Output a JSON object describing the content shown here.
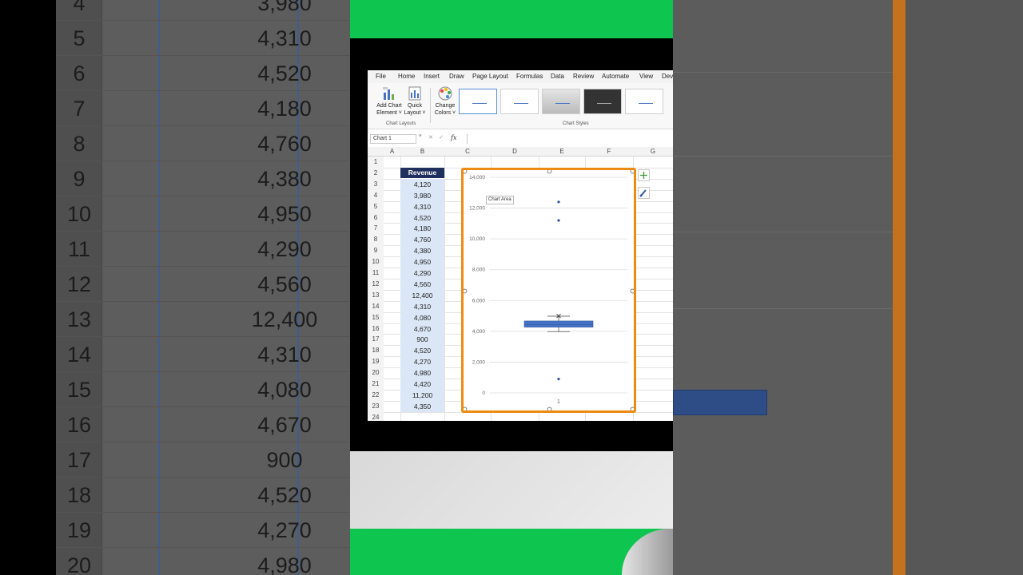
{
  "background_sheet": {
    "rows": [
      {
        "n": "4",
        "v": "3,980"
      },
      {
        "n": "5",
        "v": "4,310"
      },
      {
        "n": "6",
        "v": "4,520"
      },
      {
        "n": "7",
        "v": "4,180"
      },
      {
        "n": "8",
        "v": "4,760"
      },
      {
        "n": "9",
        "v": "4,380"
      },
      {
        "n": "10",
        "v": "4,950"
      },
      {
        "n": "11",
        "v": "4,290"
      },
      {
        "n": "12",
        "v": "4,560"
      },
      {
        "n": "13",
        "v": "12,400"
      },
      {
        "n": "14",
        "v": "4,310"
      },
      {
        "n": "15",
        "v": "4,080"
      },
      {
        "n": "16",
        "v": "4,670"
      },
      {
        "n": "17",
        "v": "900"
      },
      {
        "n": "18",
        "v": "4,520"
      },
      {
        "n": "19",
        "v": "4,270"
      },
      {
        "n": "20",
        "v": "4,980"
      }
    ]
  },
  "menu": [
    "File",
    "Home",
    "Insert",
    "Draw",
    "Page Layout",
    "Formulas",
    "Data",
    "Review",
    "Automate",
    "View",
    "Dev"
  ],
  "ribbon": {
    "add_chart_element": [
      "Add Chart",
      "Element ˅"
    ],
    "quick_layout": [
      "Quick",
      "Layout ˅"
    ],
    "change_colors": [
      "Change",
      "Colors ˅"
    ],
    "group_chart_layouts": "Chart Layouts",
    "group_chart_styles": "Chart Styles"
  },
  "formula_bar": {
    "name_box": "Chart 1",
    "fx": "fx"
  },
  "columns": [
    "A",
    "B",
    "C",
    "D",
    "E",
    "F",
    "G"
  ],
  "rows": [
    "1",
    "2",
    "3",
    "4",
    "5",
    "6",
    "7",
    "8",
    "9",
    "10",
    "11",
    "12",
    "13",
    "14",
    "15",
    "16",
    "17",
    "18",
    "19",
    "20",
    "21",
    "22",
    "23",
    "24"
  ],
  "table": {
    "header": "Revenue",
    "values": [
      "4,120",
      "3,980",
      "4,310",
      "4,520",
      "4,180",
      "4,760",
      "4,380",
      "4,950",
      "4,290",
      "4,560",
      "12,400",
      "4,310",
      "4,080",
      "4,670",
      "900",
      "4,520",
      "4,270",
      "4,980",
      "4,420",
      "11,200",
      "4,350"
    ]
  },
  "tooltip": "Chart Area",
  "chart_data": {
    "type": "box",
    "categories": [
      "1"
    ],
    "ylim": [
      0,
      14000
    ],
    "yticks": [
      "0",
      "2,000",
      "4,000",
      "6,000",
      "8,000",
      "10,000",
      "12,000",
      "14,000"
    ],
    "ytick_values": [
      0,
      2000,
      4000,
      6000,
      8000,
      10000,
      12000,
      14000
    ],
    "box": {
      "q1": 4270,
      "median": 4420,
      "q3": 4670,
      "whisker_low": 3980,
      "whisker_high": 4980,
      "mean": 5000
    },
    "outliers": [
      12400,
      11200,
      900
    ],
    "grid": true,
    "colors": {
      "box": "#4472c4",
      "selection": "#ec8a12"
    }
  }
}
